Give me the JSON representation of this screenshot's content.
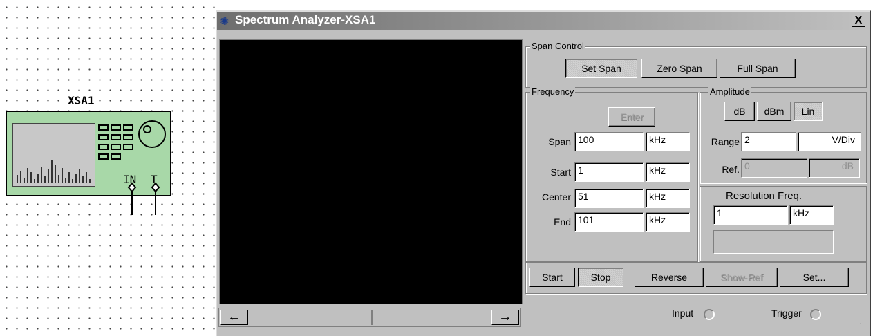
{
  "schematic": {
    "component_label": "XSA1",
    "terminals": {
      "input": "IN",
      "trigger": "T"
    }
  },
  "window": {
    "title": "Spectrum Analyzer-XSA1",
    "close_label": "X"
  },
  "scrollbar": {
    "left_arrow": "←",
    "right_arrow": "→"
  },
  "span_control": {
    "title": "Span Control",
    "set_span": "Set Span",
    "zero_span": "Zero Span",
    "full_span": "Full Span",
    "selected": "Set Span"
  },
  "frequency": {
    "title": "Frequency",
    "enter_label": "Enter",
    "span": {
      "label": "Span",
      "value": "100",
      "unit": "kHz"
    },
    "start": {
      "label": "Start",
      "value": "1",
      "unit": "kHz"
    },
    "center": {
      "label": "Center",
      "value": "51",
      "unit": "kHz"
    },
    "end": {
      "label": "End",
      "value": "101",
      "unit": "kHz"
    }
  },
  "amplitude": {
    "title": "Amplitude",
    "db": "dB",
    "dbm": "dBm",
    "lin": "Lin",
    "selected": "Lin",
    "range": {
      "label": "Range",
      "value": "2",
      "unit": "V/Div"
    },
    "ref": {
      "label": "Ref.",
      "value": "0",
      "unit": "dB"
    }
  },
  "resolution": {
    "title": "Resolution Freq.",
    "value": "1",
    "unit": "kHz"
  },
  "controls": {
    "start": "Start",
    "stop": "Stop",
    "reverse": "Reverse",
    "show_ref": "Show-Ref",
    "set": "Set..."
  },
  "io": {
    "input": "Input",
    "trigger": "Trigger"
  },
  "colors": {
    "screen": "#000000",
    "face": "#c0c0c0",
    "instrument": "#a8d8a8"
  }
}
